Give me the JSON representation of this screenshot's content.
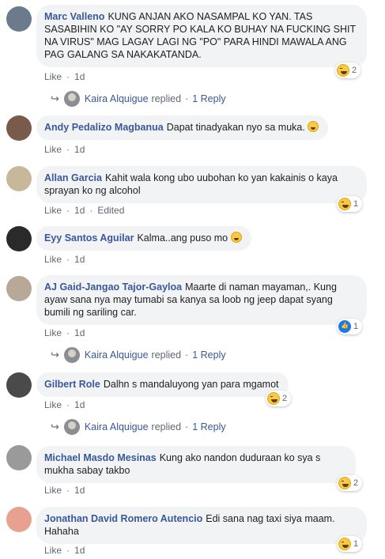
{
  "comments": [
    {
      "name": "Marc Valleno",
      "text": "KUNG ANJAN AKO NASAMPAL KO YAN. TAS SASABIHIN KO \"AY SORRY PO KALA KO BUHAY NA FUCKING SHIT NA VIRUS\" MAG LAGAY LAGI NG \"PO\" PARA HINDI MAWALA ANG PAG GALANG SA NAKAKATANDA.",
      "like": "Like",
      "time": "1d",
      "reaction_count": "2",
      "reaction_type": "haha",
      "avatar_color": "#6b7b8c"
    },
    {
      "name": "Andy Pedalizo Magbanua",
      "text": "Dapat tinadyakan nyo sa muka.",
      "like": "Like",
      "time": "1d",
      "avatar_color": "#7a5a4a"
    },
    {
      "name": "Allan Garcia",
      "text": "Kahit wala kong ubo uubohan ko yan kakainis o kaya sprayan ko ng alcohol",
      "like": "Like",
      "time": "1d",
      "edited": "Edited",
      "reaction_count": "1",
      "reaction_type": "haha",
      "avatar_color": "#c8b89a"
    },
    {
      "name": "Eyy Santos Aguilar",
      "text": "Kalma..ang puso mo",
      "like": "Like",
      "time": "1d",
      "avatar_color": "#2a2a2a"
    },
    {
      "name": "AJ Gaid-Jangao Tajor-Gayloa",
      "text": "Maarte di naman mayaman,. Kung ayaw sana nya may tumabi sa kanya sa loob ng jeep dapat syang bumili ng sariling car.",
      "like": "Like",
      "time": "1d",
      "reaction_count": "1",
      "reaction_type": "like",
      "avatar_color": "#b8a898"
    },
    {
      "name": "Gilbert Role",
      "text": "Dalhn s mandaluyong yan para mgamot",
      "like": "Like",
      "time": "1d",
      "reaction_count": "2",
      "reaction_type": "haha",
      "avatar_color": "#4a4a4a"
    },
    {
      "name": "Michael Masdo Mesinas",
      "text": "Kung ako nandon duduraan ko sya s mukha sabay takbo",
      "like": "Like",
      "time": "1d",
      "reaction_count": "2",
      "reaction_type": "haha",
      "avatar_color": "#9a9a9a"
    },
    {
      "name": "Jonathan David Romero Autencio",
      "text": "Edi sana nag taxi siya maam. Hahaha",
      "like": "Like",
      "time": "1d",
      "reaction_count": "1",
      "reaction_type": "haha",
      "avatar_color": "#e8a090"
    }
  ],
  "replies": [
    {
      "name": "Kaira Alquigue",
      "action": "replied",
      "count": "1 Reply"
    },
    {
      "name": "Kaira Alquigue",
      "action": "replied",
      "count": "1 Reply"
    },
    {
      "name": "Kaira Alquigue",
      "action": "replied",
      "count": "1 Reply"
    }
  ],
  "separator": "·"
}
